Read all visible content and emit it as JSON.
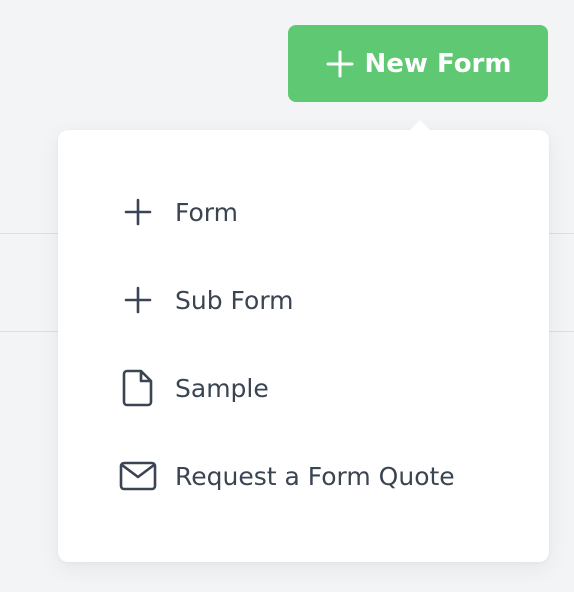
{
  "header": {
    "new_form_button": {
      "label": "New Form",
      "icon": "plus-icon",
      "color": "#5ec872"
    }
  },
  "dropdown_menu": {
    "items": [
      {
        "label": "Form",
        "icon": "plus-icon"
      },
      {
        "label": "Sub Form",
        "icon": "plus-icon"
      },
      {
        "label": "Sample",
        "icon": "file-icon"
      },
      {
        "label": "Request a Form Quote",
        "icon": "mail-icon"
      }
    ]
  },
  "colors": {
    "accent": "#5ec872",
    "text": "#3a4452",
    "background": "#f3f4f6",
    "menu_background": "#ffffff"
  }
}
